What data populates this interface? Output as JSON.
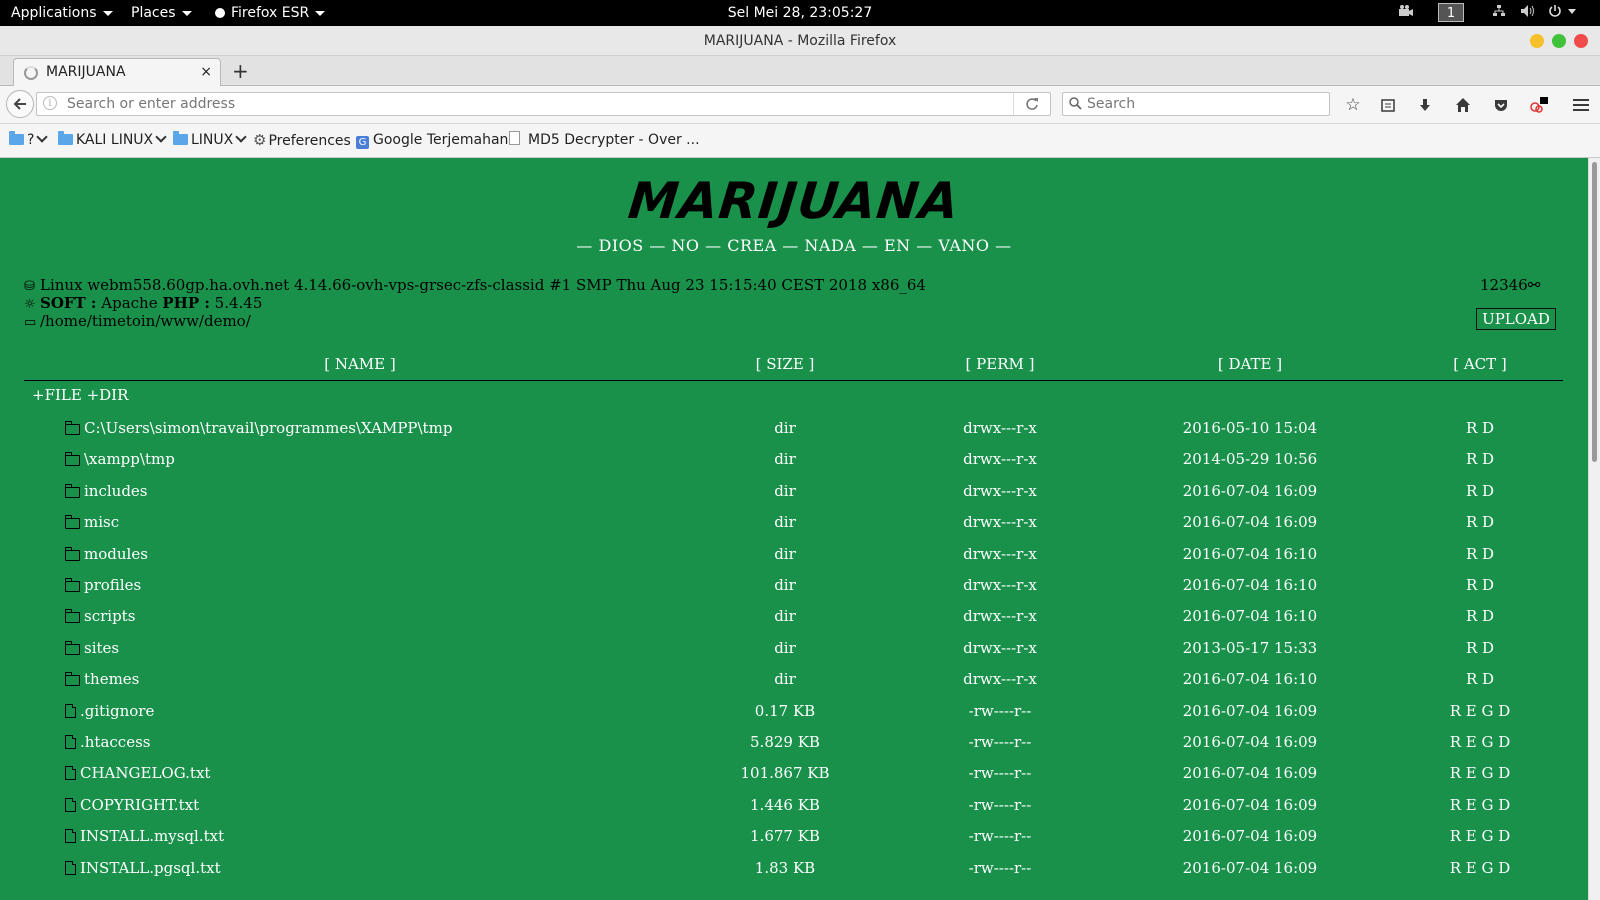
{
  "panel": {
    "applications": "Applications",
    "places": "Places",
    "browser": "Firefox ESR",
    "clock": "Sel Mei 28, 23:05:27",
    "workspace": "1"
  },
  "window": {
    "title": "MARIJUANA - Mozilla Firefox"
  },
  "tab": {
    "label": "MARIJUANA",
    "close": "×",
    "new": "+"
  },
  "navbar": {
    "url_placeholder": "Search or enter address",
    "search_placeholder": "Search"
  },
  "bookmarks": [
    {
      "label": "?",
      "type": "folder"
    },
    {
      "label": "KALI LINUX",
      "type": "folder"
    },
    {
      "label": "LINUX",
      "type": "folder"
    },
    {
      "label": "Preferences",
      "type": "gear"
    },
    {
      "label": "Google Terjemahan",
      "type": "translate"
    },
    {
      "label": "MD5 Decrypter - Over ...",
      "type": "page"
    }
  ],
  "page": {
    "logo": "MARIJUANA",
    "tagline": "— DIOS — NO — CREA — NADA — EN — VANO —",
    "uname": "Linux webm558.60gp.ha.ovh.net 4.14.66-ovh-vps-grsec-zfs-classid #1 SMP Thu Aug 23 15:15:40 CEST 2018 x86_64",
    "soft_label": "SOFT :",
    "soft_value": "Apache",
    "php_label": "PHP :",
    "php_value": "5.4.45",
    "path": "/home/timetoin/www/demo/",
    "id": "12346",
    "upload": "UPLOAD",
    "new_links": "+FILE +DIR"
  },
  "table": {
    "headers": {
      "name": "[ NAME ]",
      "size": "[ SIZE ]",
      "perm": "[ PERM ]",
      "date": "[ DATE ]",
      "act": "[ ACT ]"
    },
    "rows": [
      {
        "type": "dir",
        "name": "C:\\Users\\simon\\travail\\programmes\\XAMPP\\tmp",
        "size": "dir",
        "perm": "drwx---r-x",
        "date": "2016-05-10 15:04",
        "act": "R D"
      },
      {
        "type": "dir",
        "name": "\\xampp\\tmp",
        "size": "dir",
        "perm": "drwx---r-x",
        "date": "2014-05-29 10:56",
        "act": "R D"
      },
      {
        "type": "dir",
        "name": "includes",
        "size": "dir",
        "perm": "drwx---r-x",
        "date": "2016-07-04 16:09",
        "act": "R D"
      },
      {
        "type": "dir",
        "name": "misc",
        "size": "dir",
        "perm": "drwx---r-x",
        "date": "2016-07-04 16:09",
        "act": "R D"
      },
      {
        "type": "dir",
        "name": "modules",
        "size": "dir",
        "perm": "drwx---r-x",
        "date": "2016-07-04 16:10",
        "act": "R D"
      },
      {
        "type": "dir",
        "name": "profiles",
        "size": "dir",
        "perm": "drwx---r-x",
        "date": "2016-07-04 16:10",
        "act": "R D"
      },
      {
        "type": "dir",
        "name": "scripts",
        "size": "dir",
        "perm": "drwx---r-x",
        "date": "2016-07-04 16:10",
        "act": "R D"
      },
      {
        "type": "dir",
        "name": "sites",
        "size": "dir",
        "perm": "drwx---r-x",
        "date": "2013-05-17 15:33",
        "act": "R D"
      },
      {
        "type": "dir",
        "name": "themes",
        "size": "dir",
        "perm": "drwx---r-x",
        "date": "2016-07-04 16:10",
        "act": "R D"
      },
      {
        "type": "file",
        "name": ".gitignore",
        "size": "0.17 KB",
        "perm": "-rw----r--",
        "date": "2016-07-04 16:09",
        "act": "R E G D"
      },
      {
        "type": "file",
        "name": ".htaccess",
        "size": "5.829 KB",
        "perm": "-rw----r--",
        "date": "2016-07-04 16:09",
        "act": "R E G D"
      },
      {
        "type": "file",
        "name": "CHANGELOG.txt",
        "size": "101.867 KB",
        "perm": "-rw----r--",
        "date": "2016-07-04 16:09",
        "act": "R E G D"
      },
      {
        "type": "file",
        "name": "COPYRIGHT.txt",
        "size": "1.446 KB",
        "perm": "-rw----r--",
        "date": "2016-07-04 16:09",
        "act": "R E G D"
      },
      {
        "type": "file",
        "name": "INSTALL.mysql.txt",
        "size": "1.677 KB",
        "perm": "-rw----r--",
        "date": "2016-07-04 16:09",
        "act": "R E G D"
      },
      {
        "type": "file",
        "name": "INSTALL.pgsql.txt",
        "size": "1.83 KB",
        "perm": "-rw----r--",
        "date": "2016-07-04 16:09",
        "act": "R E G D"
      }
    ]
  },
  "colors": {
    "page_bg": "#1a914b",
    "panel_bg": "#000000"
  }
}
